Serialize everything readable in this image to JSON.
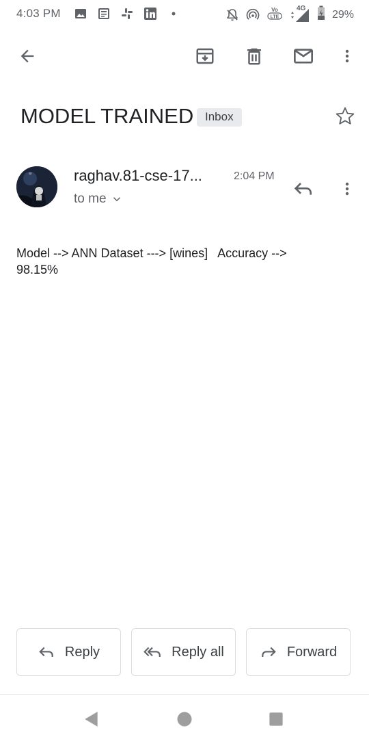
{
  "status_bar": {
    "time": "4:03 PM",
    "network": "4G",
    "volte": "VoLTE",
    "battery": "29%",
    "icons": [
      "image-icon",
      "news-icon",
      "slack-icon",
      "linkedin-icon",
      "dot-icon",
      "bell-off-icon",
      "hotspot-icon",
      "volte-icon",
      "signal-icon",
      "battery-icon"
    ]
  },
  "app_bar": {
    "icons": [
      "back-arrow-icon",
      "archive-icon",
      "delete-icon",
      "mail-icon",
      "more-vert-icon"
    ]
  },
  "email": {
    "subject": "MODEL TRAINED",
    "label": "Inbox",
    "sender": "raghav.81-cse-17...",
    "time": "2:04 PM",
    "recipients": "to me",
    "body": "Model --> ANN Dataset ---> [wines]   Accuracy -->\n98.15%"
  },
  "actions": {
    "reply": "Reply",
    "reply_all": "Reply all",
    "forward": "Forward"
  },
  "colors": {
    "text_primary": "#202124",
    "text_secondary": "#5f6368",
    "chip_bg": "#e8eaed",
    "border": "#dadce0",
    "nav_icon": "#9e9e9e"
  }
}
